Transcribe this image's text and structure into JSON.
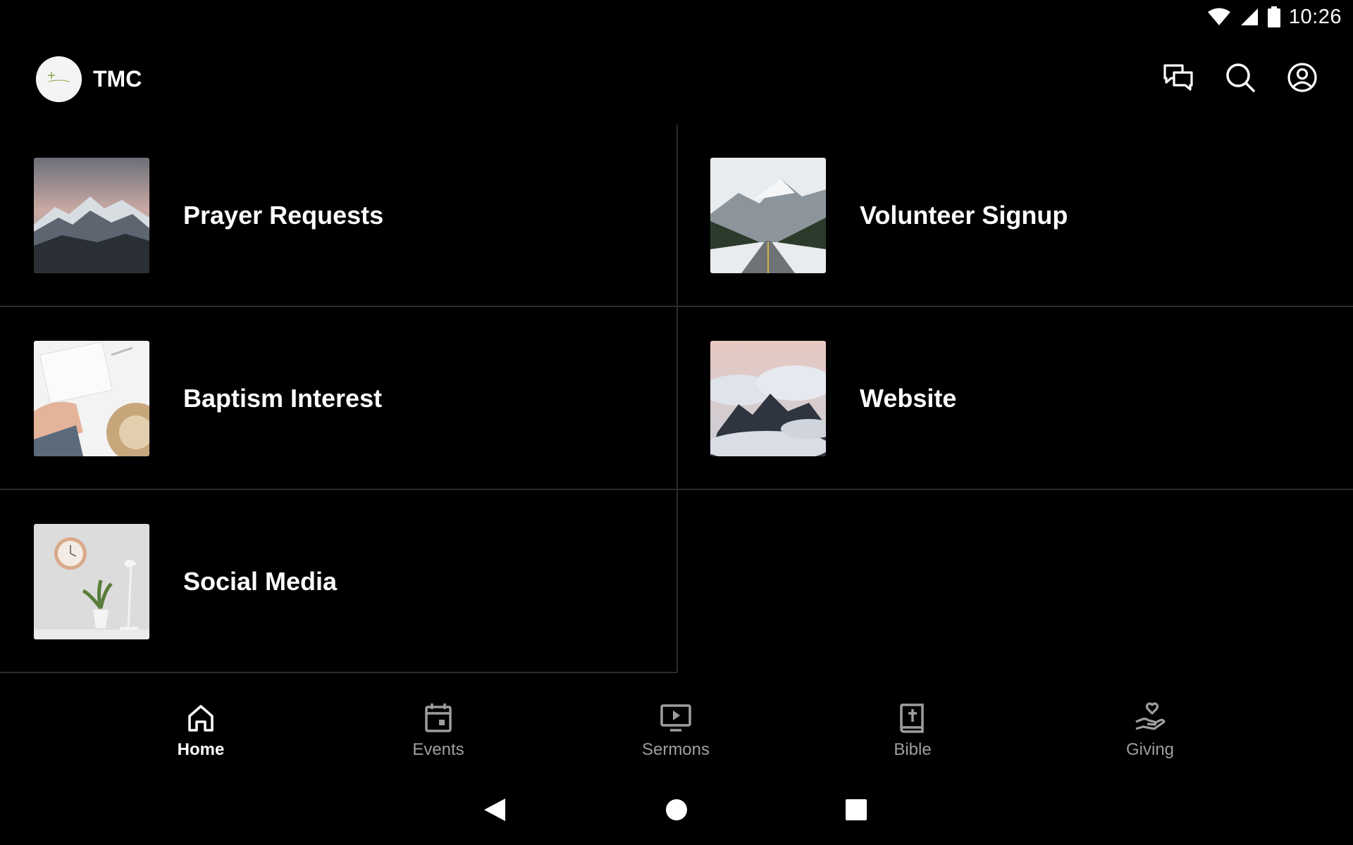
{
  "status_bar": {
    "time": "10:26"
  },
  "app_bar": {
    "title": "TMC",
    "icons": [
      "chat-icon",
      "search-icon",
      "account-icon"
    ]
  },
  "tiles": [
    {
      "label": "Prayer Requests",
      "image": "snowy-mountains-photo"
    },
    {
      "label": "Volunteer Signup",
      "image": "mountain-road-photo"
    },
    {
      "label": "Baptism Interest",
      "image": "writing-hat-photo"
    },
    {
      "label": "Website",
      "image": "clouds-peaks-photo"
    },
    {
      "label": "Social Media",
      "image": "clock-plant-photo"
    }
  ],
  "bottom_nav": {
    "items": [
      {
        "label": "Home",
        "icon": "home-icon",
        "active": true
      },
      {
        "label": "Events",
        "icon": "calendar-icon",
        "active": false
      },
      {
        "label": "Sermons",
        "icon": "tv-play-icon",
        "active": false
      },
      {
        "label": "Bible",
        "icon": "bible-icon",
        "active": false
      },
      {
        "label": "Giving",
        "icon": "giving-hand-icon",
        "active": false
      }
    ]
  },
  "colors": {
    "background": "#000000",
    "divider": "#2b2b2b",
    "nav_inactive": "#9e9e9e",
    "text": "#ffffff"
  }
}
